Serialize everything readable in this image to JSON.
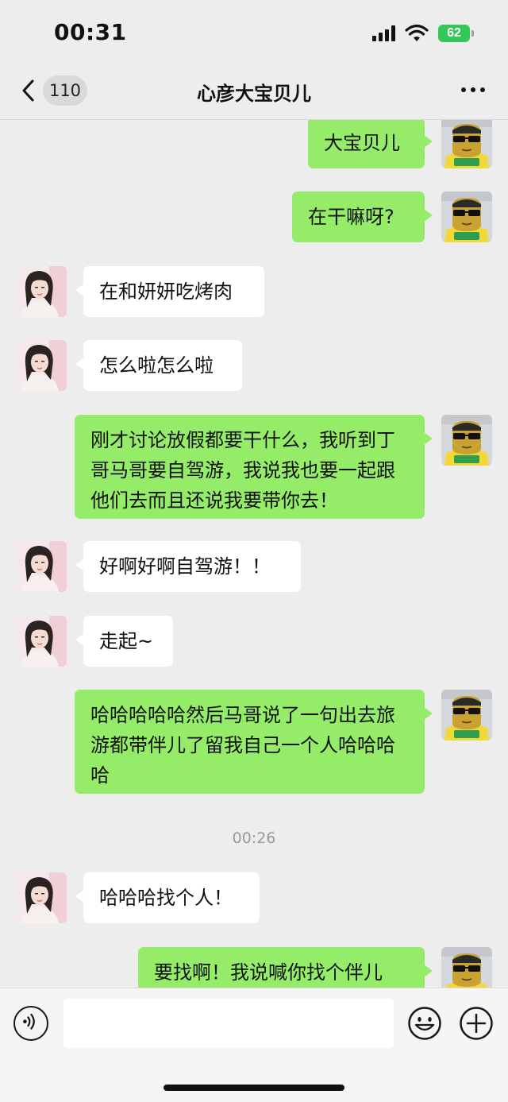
{
  "status_bar": {
    "time": "00:31",
    "battery_level": "62"
  },
  "nav": {
    "back_count": "110",
    "title": "心彦大宝贝儿"
  },
  "messages": [
    {
      "side": "right",
      "text": "大宝贝儿"
    },
    {
      "side": "right",
      "text": "在干嘛呀?"
    },
    {
      "side": "left",
      "text": "在和妍妍吃烤肉"
    },
    {
      "side": "left",
      "text": "怎么啦怎么啦"
    },
    {
      "side": "right",
      "text": "刚才讨论放假都要干什么，我听到丁哥马哥要自驾游，我说我也要一起跟他们去而且还说我要带你去！"
    },
    {
      "side": "left",
      "text": "好啊好啊自驾游！！"
    },
    {
      "side": "left",
      "text": "走起~"
    },
    {
      "side": "right",
      "text": "哈哈哈哈哈然后马哥说了一句出去旅游都带伴儿了留我自己一个人哈哈哈哈"
    },
    {
      "side": "left",
      "text": "哈哈哈找个人！"
    },
    {
      "side": "right",
      "text": "要找啊！我说喊你找个伴儿"
    }
  ],
  "time_divider": "00:26",
  "avatar_self": {
    "icon": "cartoon-man-sunglasses-avatar",
    "shirt_text": "青气风发"
  },
  "avatar_contact": {
    "icon": "woman-photo-avatar"
  },
  "input_bar": {
    "voice_icon": "voice-icon",
    "message_value": "",
    "emoji_icon": "emoji-icon",
    "plus_icon": "plus-icon"
  },
  "colors": {
    "bubble_self": "#95ec69",
    "bubble_contact": "#ffffff",
    "background": "#ededed",
    "battery": "#34c759"
  }
}
